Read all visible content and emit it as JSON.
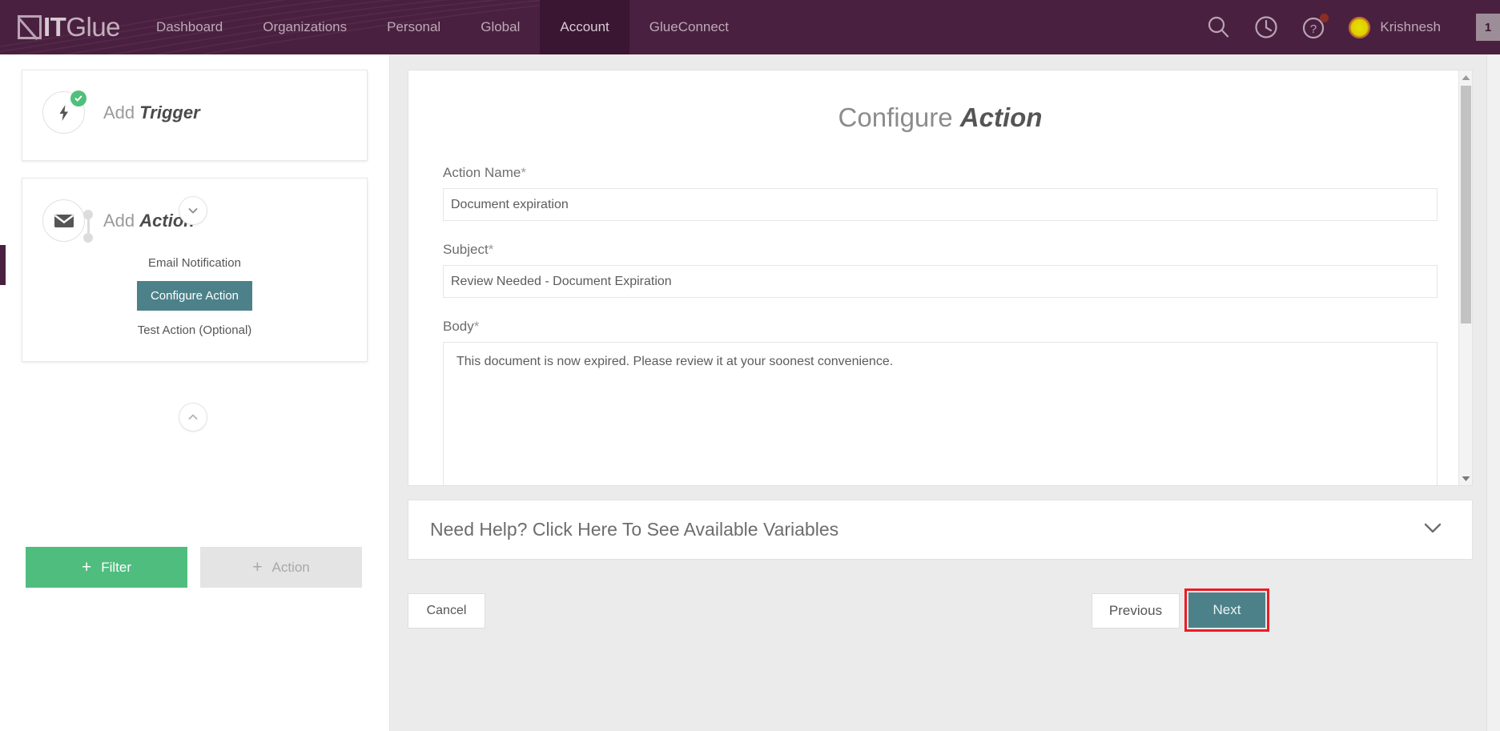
{
  "brand": {
    "logo_text_bold": "IT",
    "logo_text_light": "Glue",
    "nav_bg": "#4a2040",
    "nav_active_bg": "#3a1632",
    "accent_teal": "#4d818a",
    "accent_green": "#4fbd7e",
    "highlight_red": "#ec1c24"
  },
  "topnav": {
    "items": [
      {
        "label": "Dashboard",
        "active": false
      },
      {
        "label": "Organizations",
        "active": false
      },
      {
        "label": "Personal",
        "active": false
      },
      {
        "label": "Global",
        "active": false
      },
      {
        "label": "Account",
        "active": true
      },
      {
        "label": "GlueConnect",
        "active": false
      }
    ],
    "icons": [
      "search-icon",
      "history-clock-icon",
      "help-question-icon"
    ],
    "user_name": "Krishnesh",
    "corner_label": "1"
  },
  "workflow": {
    "trigger": {
      "title_prefix": "Add ",
      "title_bold": "Trigger",
      "icon": "lightning-bolt-icon",
      "completed": true
    },
    "action": {
      "title_prefix": "Add ",
      "title_bold": "Action",
      "icon": "envelope-icon",
      "subtitle": "Email Notification",
      "configure_label": "Configure Action",
      "test_label": "Test Action (Optional)"
    },
    "add_filter_label": "Filter",
    "add_action_label": "Action",
    "plus_glyph": "+"
  },
  "form": {
    "title_prefix": "Configure ",
    "title_bold": "Action",
    "fields": [
      {
        "label": "Action Name",
        "required": true,
        "value": "Document expiration",
        "placeholder": "",
        "type": "input"
      },
      {
        "label": "Subject",
        "required": true,
        "value": "Review Needed - Document Expiration",
        "placeholder": "",
        "type": "input"
      },
      {
        "label": "Body",
        "required": true,
        "value": "This document is now expired. Please review it at your soonest convenience.",
        "placeholder": "",
        "type": "textarea"
      }
    ],
    "required_marker": "*"
  },
  "help_bar": {
    "text": "Need Help? Click Here To See Available Variables",
    "chevron": "chevron-down-icon"
  },
  "footer": {
    "cancel_label": "Cancel",
    "previous_label": "Previous",
    "next_label": "Next",
    "next_highlighted": true
  }
}
